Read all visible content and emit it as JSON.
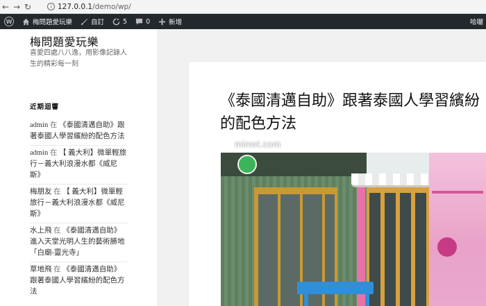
{
  "browser": {
    "url_host": "127.0.0.1",
    "url_path": "/demo/wp/"
  },
  "admin_bar": {
    "site_name": "梅問題愛玩樂",
    "customize": "自訂",
    "updates_count": "5",
    "comments_count": "0",
    "new_label": "新增",
    "user_greeting": "哈囉"
  },
  "sidebar": {
    "site_title": "梅問題愛玩樂",
    "site_description": "喜愛四處八八逸，用影像記錄人生的精彩每一刻",
    "widget_title": "近期迴響",
    "on_word": "在",
    "comments": [
      {
        "author": "admin",
        "post": "《泰國清邁自助》跟著泰國人學習繽紛的配色方法"
      },
      {
        "author": "admin",
        "post": "【 義大利】微單輕旅行－義大利浪漫水都《威尼斯》"
      },
      {
        "author": "梅朋友",
        "post": "【 義大利】微單輕旅行－義大利浪漫水都《威尼斯》"
      },
      {
        "author": "水上飛",
        "post": "《泰國清邁自助》進入天堂光明人生的藝術勝地「白廟-靈光寺」"
      },
      {
        "author": "草地飛",
        "post": "《泰國清邁自助》跟著泰國人學習繽紛的配色方法"
      }
    ]
  },
  "article": {
    "title": "《泰國清邁自助》跟著泰國人學習繽紛的配色方法"
  },
  "photo": {
    "watermark": "minwt.com"
  },
  "colors": {
    "admin_bar_bg": "#23282d",
    "page_bg": "#f1f1f1"
  }
}
